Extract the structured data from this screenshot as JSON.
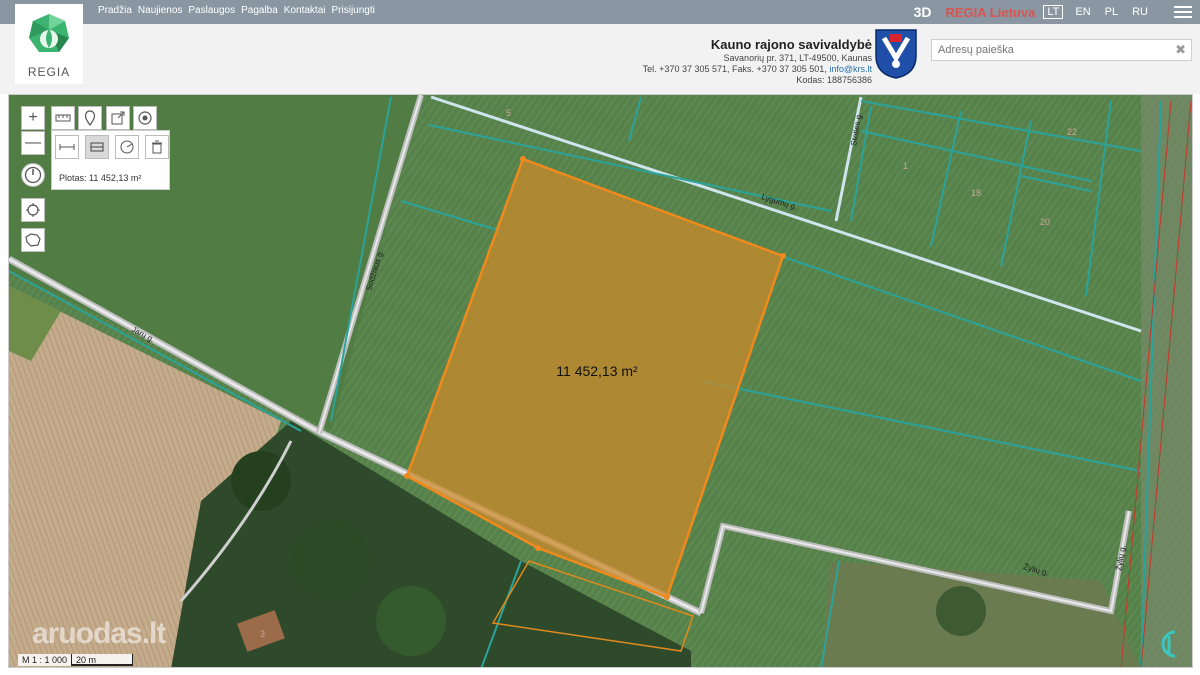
{
  "nav": {
    "items": [
      "Pradžia",
      "Naujienos",
      "Paslaugos",
      "Pagalba",
      "Kontaktai",
      "Prisijungti"
    ],
    "btn_3d": "3D",
    "regia_lietuva": "REGIA Lietuva",
    "languages": [
      "LT",
      "EN",
      "PL",
      "RU"
    ],
    "active_language": "LT"
  },
  "logo": {
    "text": "REGIA"
  },
  "municipality": {
    "name": "Kauno rajono savivaldybė",
    "address": "Savanorių pr. 371, LT-49500, Kaunas",
    "phone_prefix": "Tel. +370 37 305 571, Faks. +370 37 305 501,",
    "email": "info@krs.lt",
    "code": "Kodas: 188756386"
  },
  "search": {
    "placeholder": "Adresų paieška",
    "value": ""
  },
  "map": {
    "measurement_label": "11 452,13 m²",
    "area_readout": "Plotas: 11 452,13 m²",
    "street_labels": [
      "Jaru g.",
      "Sodžiaus g.",
      "Lygumų g.",
      "Stoties g.",
      "Žylių g."
    ],
    "parcel_numbers": [
      "5",
      "1",
      "18",
      "22",
      "20",
      "3"
    ],
    "scale_ratio": "M 1 : 1 000",
    "scale_length": "20 m",
    "watermark": "aruodas.lt",
    "colors": {
      "field": "#4f7a45",
      "boundary": "#2aa39a",
      "polygon_fill": "#c98a2a",
      "polygon_stroke": "#f08a1c"
    }
  },
  "controls": {
    "zoom_in": "+",
    "zoom_out": "—"
  }
}
